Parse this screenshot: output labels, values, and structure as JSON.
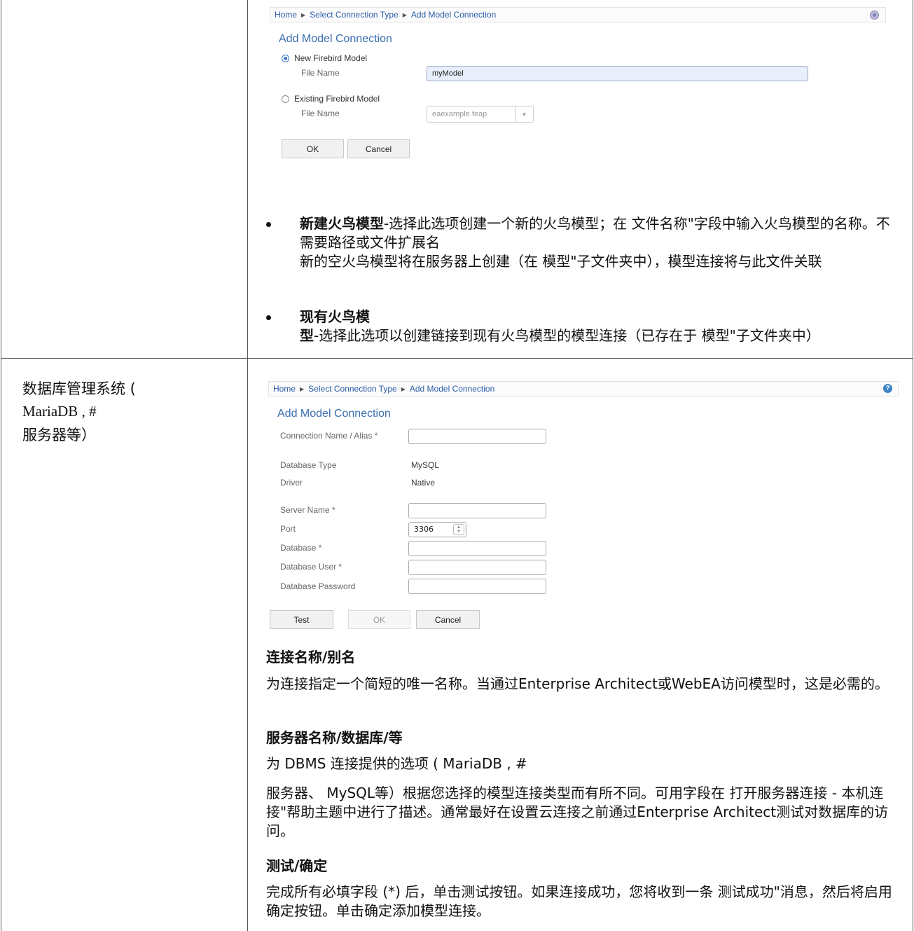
{
  "panel1": {
    "breadcrumb": [
      "Home",
      "Select Connection Type",
      "Add Model Connection"
    ],
    "title": "Add Model Connection",
    "new_option": "New Firebird Model",
    "new_file_label": "File Name",
    "new_file_value": "myModel",
    "existing_option": "Existing Firebird Model",
    "existing_file_label": "File Name",
    "existing_file_value": "eaexample.feap",
    "ok": "OK",
    "cancel": "Cancel"
  },
  "bullets": [
    {
      "bold": "新建火鸟模型",
      "text": "-选择此选项创建一个新的火鸟模型；在  文件名称\"字段中输入火鸟模型的名称。不需要路径或文件扩展名",
      "text2": "新的空火鸟模型将在服务器上创建（在  模型\"子文件夹中），模型连接将与此文件关联"
    },
    {
      "bold": "现有火鸟模型",
      "text": "-选择此选项以创建链接到现有火鸟模型的模型连接（已存在于  模型\"子文件夹中）"
    }
  ],
  "row2_label": {
    "line1": "数据库管理系统 (",
    "line2": "MariaDB , #",
    "line3": "服务器等）"
  },
  "panel2": {
    "breadcrumb": [
      "Home",
      "Select Connection Type",
      "Add Model Connection"
    ],
    "title": "Add Model Connection",
    "conn_label": "Connection Name / Alias *",
    "dbtype_label": "Database Type",
    "dbtype_value": "MySQL",
    "driver_label": "Driver",
    "driver_value": "Native",
    "server_label": "Server Name *",
    "port_label": "Port",
    "port_value": "3306",
    "database_label": "Database *",
    "dbuser_label": "Database User *",
    "dbpass_label": "Database Password",
    "test": "Test",
    "ok": "OK",
    "cancel": "Cancel"
  },
  "sections": {
    "s1_head": "连接名称/别名",
    "s1_body": "为连接指定一个简短的唯一名称。当通过Enterprise Architect或WebEA访问模型时，这是必需的。",
    "s2_head": "服务器名称/数据库/等",
    "s2_body1": "为 DBMS 连接提供的选项 ( MariaDB , #",
    "s2_body2": "服务器、 MySQL等）根据您选择的模型连接类型而有所不同。可用字段在  打开服务器连接 - 本机连接\"帮助主题中进行了描述。通常最好在设置云连接之前通过Enterprise Architect测试对数据库的访问。",
    "s3_head": "测试/确定",
    "s3_body": "完成所有必填字段 (*) 后，单击测试按钮。如果连接成功，您将收到一条  测试成功\"消息，然后将启用确定按钮。单击确定添加模型连接。"
  }
}
